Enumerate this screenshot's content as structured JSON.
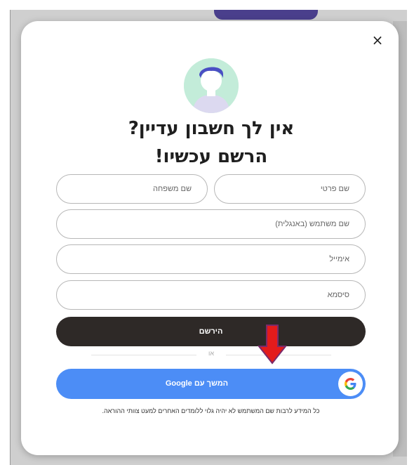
{
  "modal": {
    "close_symbol": "×",
    "title_line1": "אין לך חשבון עדיין?",
    "title_line2": "הרשם עכשיו!",
    "fields": {
      "first_name_placeholder": "שם פרטי",
      "last_name_placeholder": "שם משפחה",
      "username_placeholder": "שם משתמש (באנגלית)",
      "email_placeholder": "אימייל",
      "password_placeholder": "סיסמא"
    },
    "register_label": "הירשם",
    "or_label": "או",
    "google_label": "המשך עם Google",
    "note": "כל המידע לרבות שם המשתמש לא יהיה גלוי ללומדים האחרים למעט צוותי ההוראה."
  },
  "colors": {
    "register_bg": "#2e2927",
    "google_bg": "#4c8df6",
    "arrow": "#e31b1b",
    "avatar_bg": "#c3ecd9",
    "avatar_hair": "#4a4fc4"
  },
  "icons": [
    "close-icon",
    "avatar-icon",
    "google-g-icon",
    "red-down-arrow-icon"
  ]
}
